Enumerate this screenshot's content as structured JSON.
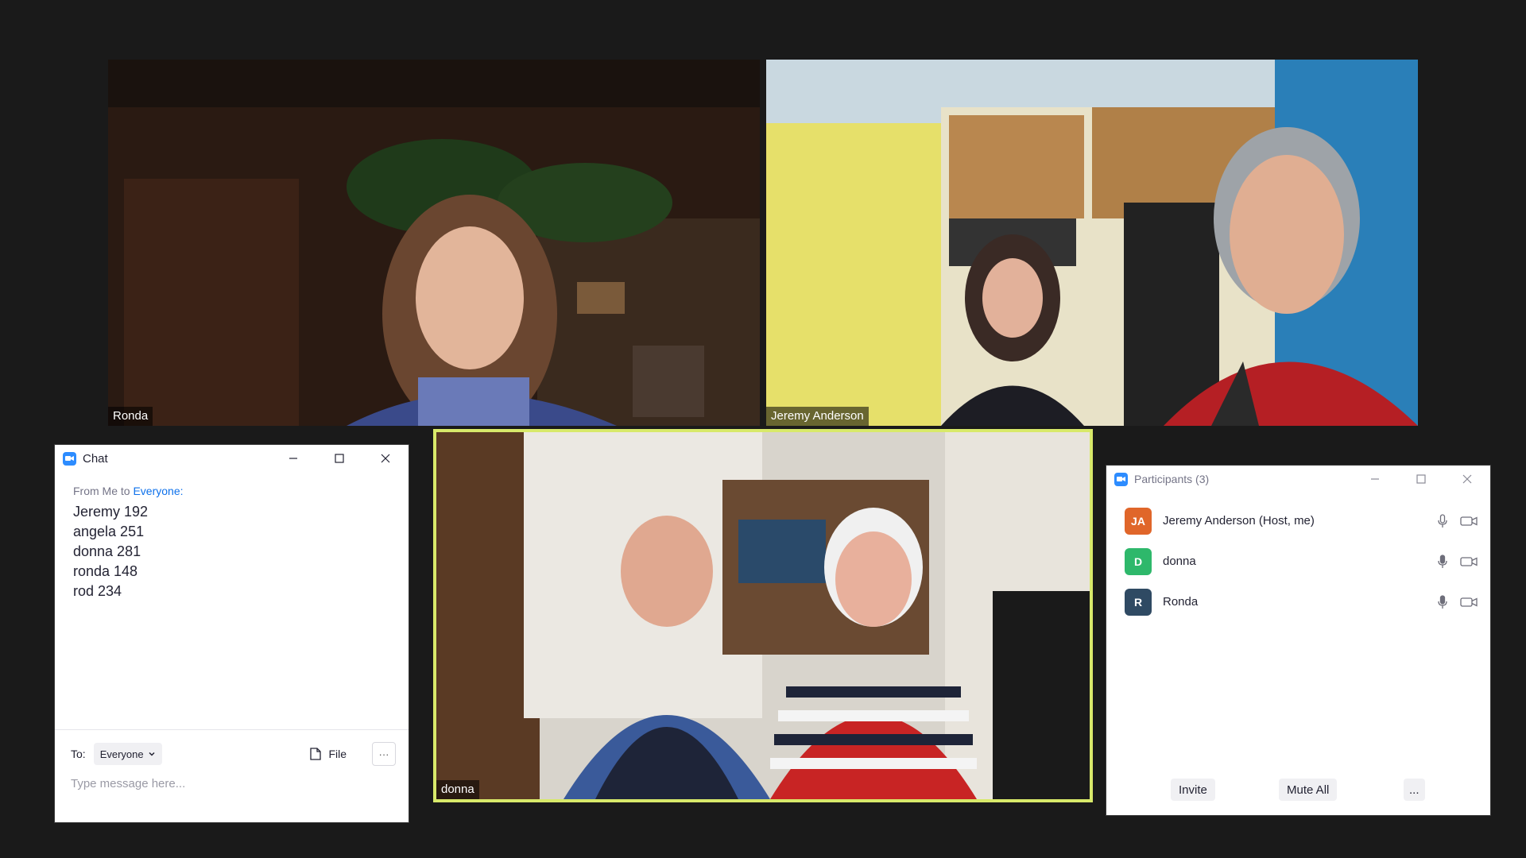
{
  "video_tiles": {
    "ronda": {
      "name": "Ronda"
    },
    "jeremy": {
      "name": "Jeremy Anderson"
    },
    "donna": {
      "name": "donna"
    }
  },
  "chat": {
    "title": "Chat",
    "from_label": "From Me to",
    "to_recipient": "Everyone:",
    "messages": [
      "Jeremy 192",
      "angela 251",
      "donna 281",
      "ronda 148",
      "rod 234"
    ],
    "to_label": "To:",
    "to_value": "Everyone",
    "file_label": "File",
    "more_label": "···",
    "input_placeholder": "Type message here..."
  },
  "participants": {
    "title": "Participants (3)",
    "list": [
      {
        "initials": "JA",
        "name": "Jeremy Anderson (Host, me)",
        "color": "#e0662a"
      },
      {
        "initials": "D",
        "name": "donna",
        "color": "#2eb86b"
      },
      {
        "initials": "R",
        "name": "Ronda",
        "color": "#2f4a63"
      }
    ],
    "invite_label": "Invite",
    "mute_all_label": "Mute All",
    "more_label": "..."
  },
  "colors": {
    "background": "#1a1a1a",
    "active_speaker_border": "#d8e96a",
    "accent_blue": "#2d8cff"
  },
  "icons": [
    "zoom-app-icon",
    "minimize-icon",
    "maximize-icon",
    "close-icon",
    "chevron-down-icon",
    "file-icon",
    "microphone-icon",
    "video-camera-icon"
  ]
}
